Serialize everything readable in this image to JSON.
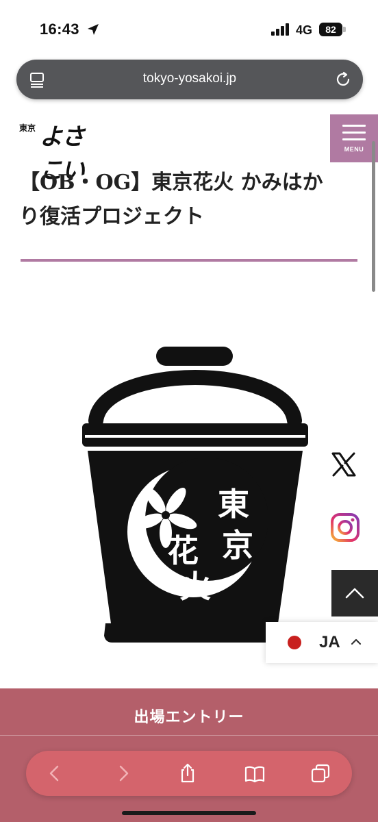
{
  "status_bar": {
    "time": "16:43",
    "network": "4G",
    "battery": "82"
  },
  "browser": {
    "url": "tokyo-yosakoi.jp"
  },
  "site": {
    "logo_small": "東京",
    "logo_main": "よさこい",
    "menu_label": "MENU",
    "accent_color": "#b07aa2"
  },
  "article": {
    "title_line1": "【OB・OG】東京花火 かみはか",
    "title_line2": "り復活プロジェクト",
    "image_text": [
      "東",
      "京",
      "花",
      "火"
    ]
  },
  "side_buttons": {
    "x_icon": "x-logo-icon",
    "instagram_icon": "instagram-icon",
    "page_top_icon": "chevron-up-icon"
  },
  "language": {
    "code": "JA"
  },
  "entry": {
    "label": "出場エントリー",
    "color": "#b45f6a"
  },
  "toolbar": {
    "icons": [
      "back-icon",
      "forward-icon",
      "share-icon",
      "bookmarks-icon",
      "tabs-icon"
    ]
  }
}
